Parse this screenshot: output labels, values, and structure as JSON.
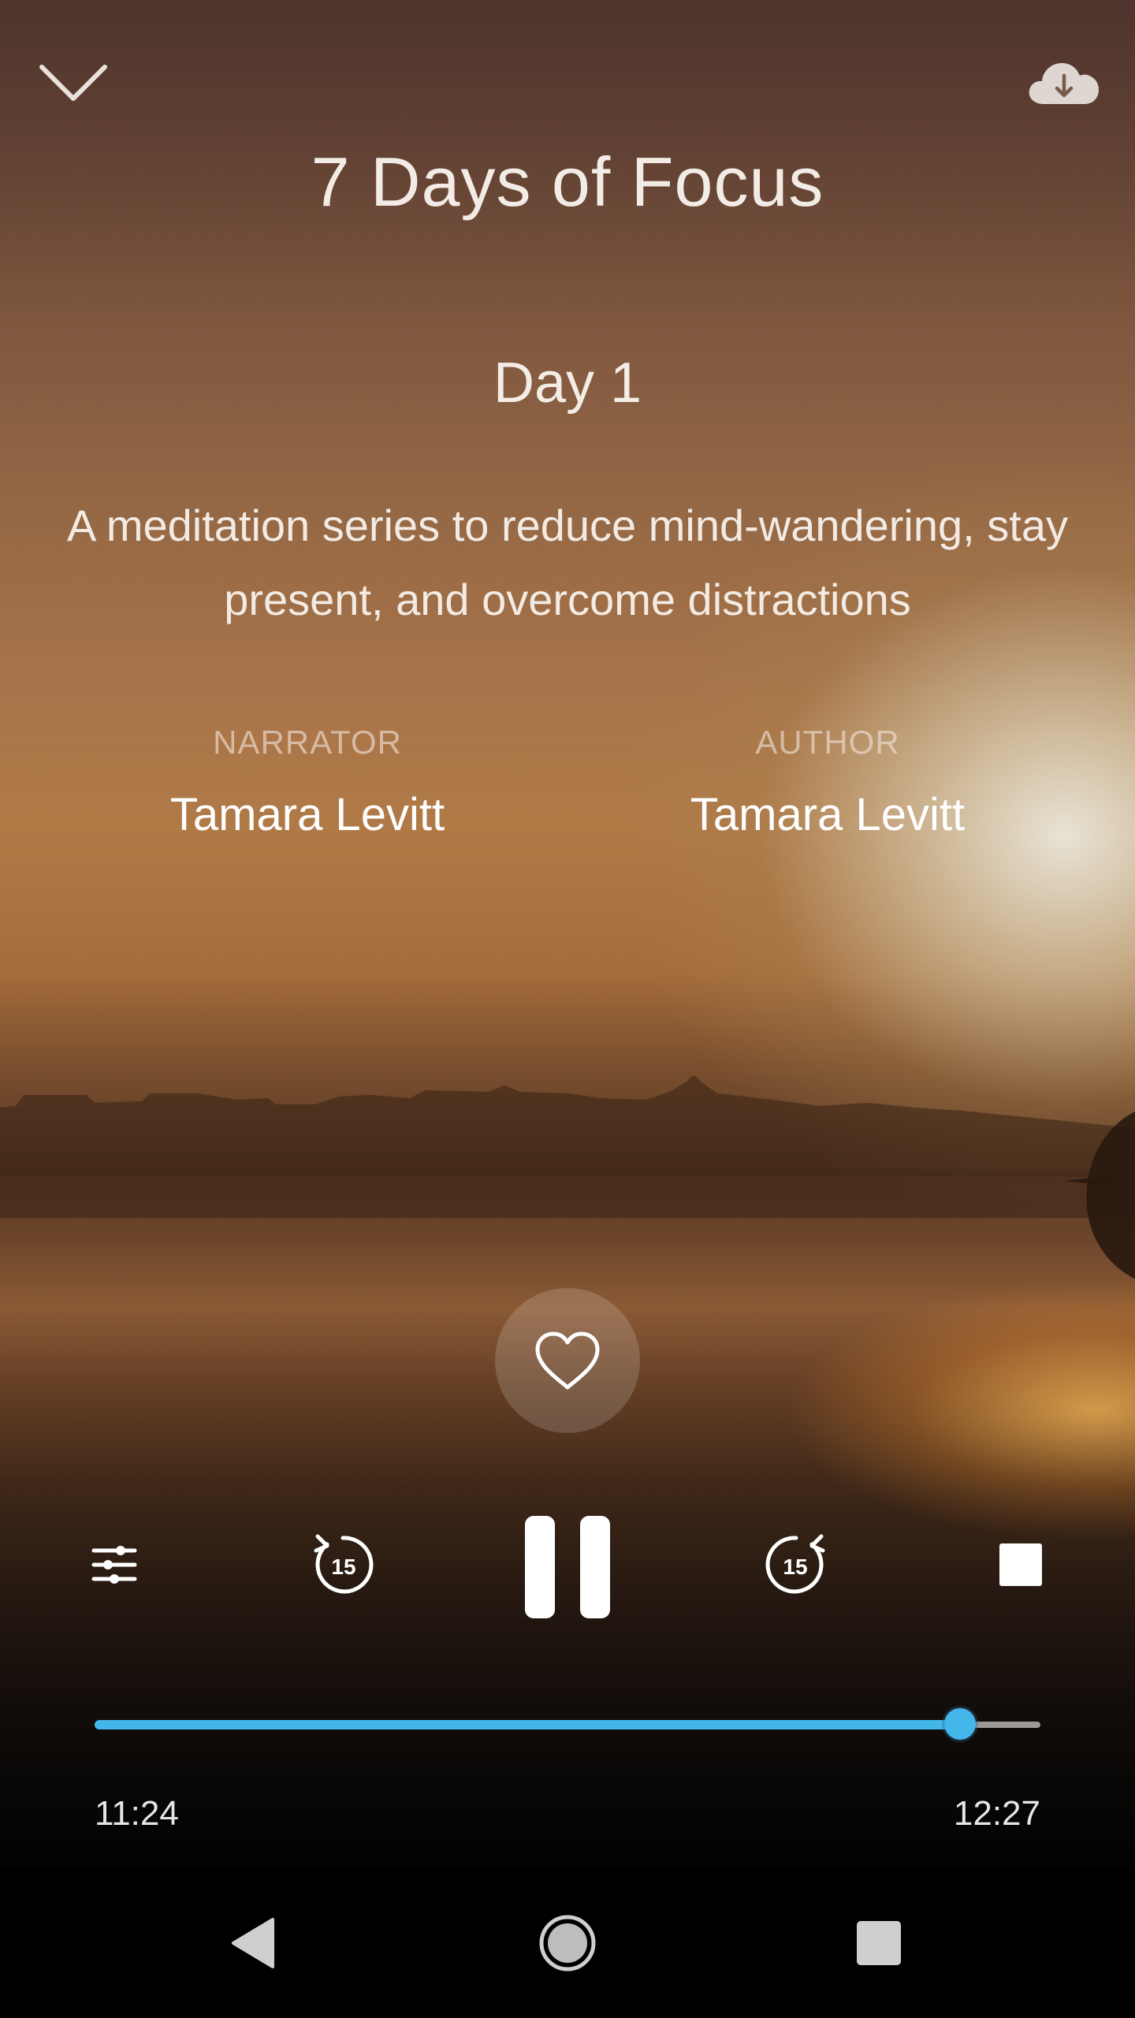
{
  "player": {
    "title": "7 Days of Focus",
    "session": "Day 1",
    "description": "A meditation series to reduce mind-wandering, stay present, and overcome distractions",
    "narrator_label": "NARRATOR",
    "narrator_name": "Tamara Levitt",
    "author_label": "AUTHOR",
    "author_name": "Tamara Levitt"
  },
  "controls": {
    "rewind_seconds": "15",
    "forward_seconds": "15"
  },
  "progress": {
    "elapsed": "11:24",
    "total": "12:27",
    "fraction": 0.915
  },
  "icons": {
    "collapse": "chevron-down-icon",
    "download": "cloud-download-icon",
    "favorite": "heart-icon",
    "settings": "sliders-icon",
    "rewind": "rewind-15-icon",
    "pause": "pause-icon",
    "forward": "forward-15-icon",
    "stop": "stop-icon",
    "nav_back": "back-triangle-icon",
    "nav_home": "home-circle-icon",
    "nav_recents": "recents-square-icon"
  },
  "colors": {
    "accent": "#43b7ea",
    "track": "#bebebe",
    "navbar": "#000000"
  }
}
